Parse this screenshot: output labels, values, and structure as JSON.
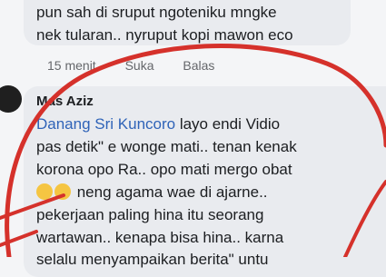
{
  "previous_comment": {
    "lines": [
      "pun sah di sruput ngoteniku mngke",
      "nek tularan.. nyruput kopi mawon eco"
    ],
    "time": "15 menit",
    "like": "Suka",
    "reply": "Balas"
  },
  "comment": {
    "author": "Mas Aziz",
    "mention": "Danang Sri Kuncoro",
    "lines": [
      " layo endi Vidio",
      "pas detik\" e wonge mati.. tenan kenak",
      "korona opo Ra.. opo mati mergo obat",
      " neng agama wae di ajarne..",
      "pekerjaan paling hina itu seorang",
      "wartawan.. kenapa bisa hina.. karna",
      "selalu menyampaikan berita\" untu"
    ]
  },
  "colors": {
    "annotation": "#d5312b",
    "mention": "#2f63b8",
    "bubble": "#e9ebef"
  }
}
